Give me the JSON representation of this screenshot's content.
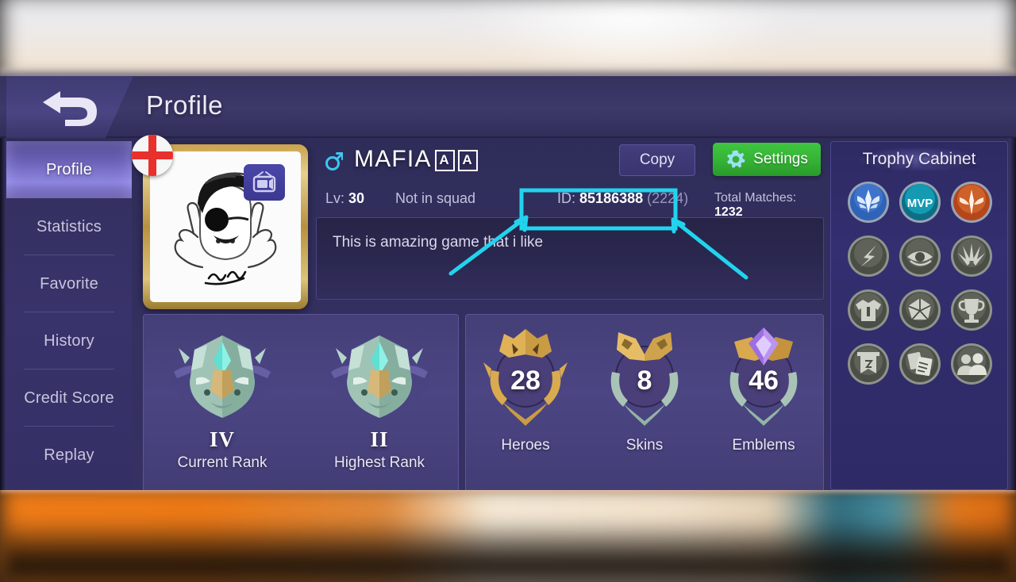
{
  "header": {
    "title": "Profile",
    "back_icon": "back-arrow-icon"
  },
  "sidebar": {
    "items": [
      {
        "label": "Profile",
        "active": true
      },
      {
        "label": "Statistics",
        "active": false
      },
      {
        "label": "Favorite",
        "active": false
      },
      {
        "label": "History",
        "active": false
      },
      {
        "label": "Credit Score",
        "active": false
      },
      {
        "label": "Replay",
        "active": false
      }
    ]
  },
  "profile": {
    "avatar": {
      "icon": "avatar-portrait",
      "flag_icon": "england-flag-icon",
      "stream_badge_icon": "tv-icon"
    },
    "gender_icon": "male-gender-icon",
    "name": "MAFIA",
    "name_suffix_glyphs": [
      "A",
      "A"
    ],
    "level_label": "Lv:",
    "level_value": "30",
    "squad_status": "Not in squad",
    "id_label": "ID:",
    "id_value": "85186388",
    "id_suffix": "(2224)",
    "matches_label": "Total Matches:",
    "matches_value": "1232",
    "bio": "This is amazing game that i like",
    "copy_label": "Copy",
    "settings_label": "Settings",
    "settings_icon": "gear-icon"
  },
  "ranks": [
    {
      "tier": "IV",
      "label": "Current Rank",
      "icon": "rank-helmet-icon"
    },
    {
      "tier": "II",
      "label": "Highest Rank",
      "icon": "rank-helmet-icon"
    }
  ],
  "stats": [
    {
      "value": "28",
      "label": "Heroes",
      "icon": "hero-crown-medal-icon"
    },
    {
      "value": "8",
      "label": "Skins",
      "icon": "skin-crown-medal-icon"
    },
    {
      "value": "46",
      "label": "Emblems",
      "icon": "emblem-crown-medal-icon"
    }
  ],
  "trophy_cabinet": {
    "title": "Trophy Cabinet",
    "slots": [
      {
        "icon": "wings-badge-icon",
        "unlocked": true,
        "color": "#2f63b8"
      },
      {
        "icon": "mvp-badge-icon",
        "unlocked": true,
        "color": "#149fb0",
        "text": "MVP"
      },
      {
        "icon": "savior-badge-icon",
        "unlocked": true,
        "color": "#c4501c"
      },
      {
        "icon": "lightning-badge-icon",
        "unlocked": false,
        "color": "#585a52"
      },
      {
        "icon": "eye-badge-icon",
        "unlocked": false,
        "color": "#585a52"
      },
      {
        "icon": "burst-badge-icon",
        "unlocked": false,
        "color": "#585a52"
      },
      {
        "icon": "jersey-badge-icon",
        "unlocked": false,
        "color": "#585a52"
      },
      {
        "icon": "gem-badge-icon",
        "unlocked": false,
        "color": "#585a52"
      },
      {
        "icon": "cup-badge-icon",
        "unlocked": false,
        "color": "#585a52"
      },
      {
        "icon": "banner-badge-icon",
        "unlocked": false,
        "color": "#585a52"
      },
      {
        "icon": "card-badge-icon",
        "unlocked": false,
        "color": "#585a52"
      },
      {
        "icon": "people-badge-icon",
        "unlocked": false,
        "color": "#585a52"
      }
    ]
  },
  "annotation": {
    "highlight_color": "#22d3ee",
    "target": "player-id-field"
  },
  "colors": {
    "accent_green": "#35b235",
    "panel_purple": "#4b4583",
    "cyan": "#22d3ee"
  }
}
